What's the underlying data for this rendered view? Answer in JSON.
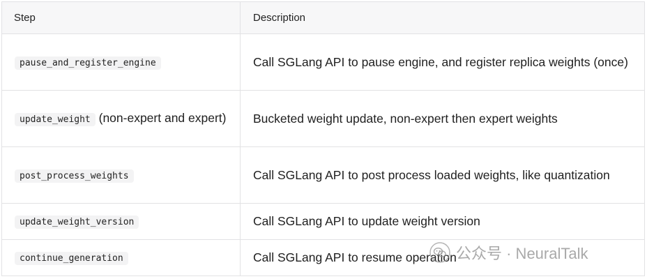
{
  "table": {
    "headers": {
      "step": "Step",
      "description": "Description"
    },
    "rows": [
      {
        "step_code": "pause_and_register_engine",
        "step_suffix": "",
        "description": "Call SGLang API to pause engine, and register replica weights (once)"
      },
      {
        "step_code": "update_weight",
        "step_suffix": " (non-expert and expert)",
        "description": "Bucketed weight update, non-expert then expert weights"
      },
      {
        "step_code": "post_process_weights",
        "step_suffix": "",
        "description": "Call SGLang API to post process loaded weights, like quantization"
      },
      {
        "step_code": "update_weight_version",
        "step_suffix": "",
        "description": "Call SGLang API to update weight version"
      },
      {
        "step_code": "continue_generation",
        "step_suffix": "",
        "description": "Call SGLang API to resume operation"
      }
    ]
  },
  "watermark": {
    "icon": "wechat-icon",
    "text": "公众号 · NeuralTalk"
  }
}
